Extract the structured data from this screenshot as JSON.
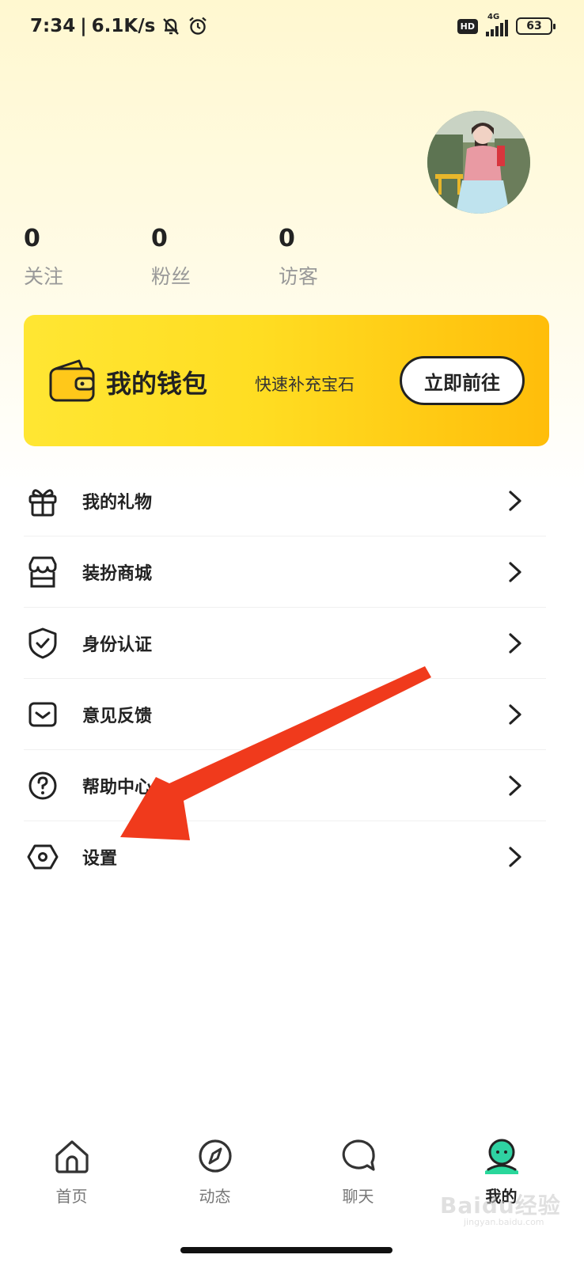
{
  "status_bar": {
    "time": "7:34",
    "separator": "|",
    "net_speed": "6.1K/s",
    "hd": "HD",
    "network": "4G",
    "battery": "63"
  },
  "profile": {
    "avatar_icon": "avatar-photo",
    "stats": [
      {
        "value": "0",
        "label": "关注"
      },
      {
        "value": "0",
        "label": "粉丝"
      },
      {
        "value": "0",
        "label": "访客"
      }
    ]
  },
  "wallet": {
    "icon": "wallet-icon",
    "title": "我的钱包",
    "subtitle": "快速补充宝石",
    "button": "立即前往",
    "gradient_start": "#ffe633",
    "gradient_end": "#ffbd0a"
  },
  "menu": [
    {
      "icon": "gift-icon",
      "label": "我的礼物"
    },
    {
      "icon": "shop-icon",
      "label": "装扮商城"
    },
    {
      "icon": "shield-check-icon",
      "label": "身份认证"
    },
    {
      "icon": "feedback-icon",
      "label": "意见反馈"
    },
    {
      "icon": "help-icon",
      "label": "帮助中心"
    },
    {
      "icon": "settings-icon",
      "label": "设置"
    }
  ],
  "tabs": [
    {
      "icon": "home-icon",
      "label": "首页",
      "active": false
    },
    {
      "icon": "compass-icon",
      "label": "动态",
      "active": false
    },
    {
      "icon": "chat-icon",
      "label": "聊天",
      "active": false
    },
    {
      "icon": "profile-icon",
      "label": "我的",
      "active": true
    }
  ],
  "annotation": {
    "color": "#f03a1c"
  },
  "watermark": {
    "text": "Baidu经验",
    "url": "jingyan.baidu.com"
  }
}
